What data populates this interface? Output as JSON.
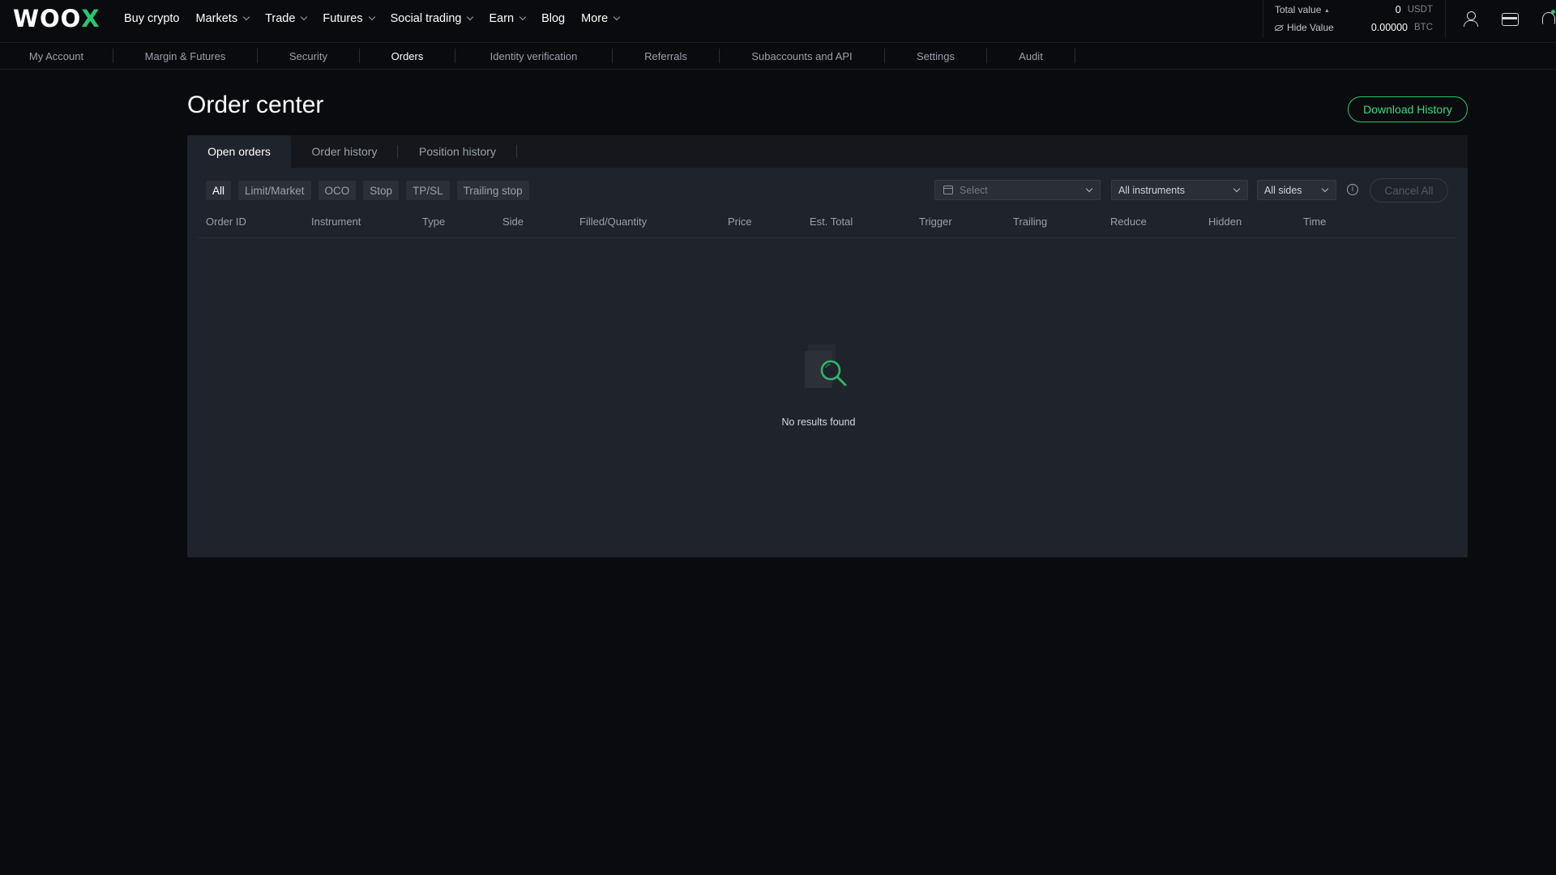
{
  "brand": {
    "logo_main": "WOO",
    "logo_accent": "X"
  },
  "topnav": {
    "items": [
      {
        "label": "Buy crypto",
        "has_menu": false
      },
      {
        "label": "Markets",
        "has_menu": true
      },
      {
        "label": "Trade",
        "has_menu": true
      },
      {
        "label": "Futures",
        "has_menu": true
      },
      {
        "label": "Social trading",
        "has_menu": true
      },
      {
        "label": "Earn",
        "has_menu": true
      },
      {
        "label": "Blog",
        "has_menu": false
      },
      {
        "label": "More",
        "has_menu": true
      }
    ]
  },
  "wallet": {
    "total_label": "Total value",
    "total_value": "0",
    "total_currency": "USDT",
    "hide_label": "Hide Value",
    "btc_value": "0.00000",
    "btc_currency": "BTC"
  },
  "subnav": {
    "items": [
      "My Account",
      "Margin & Futures",
      "Security",
      "Orders",
      "Identity verification",
      "Referrals",
      "Subaccounts and API",
      "Settings",
      "Audit"
    ],
    "active": "Orders"
  },
  "page": {
    "title": "Order center",
    "download_label": "Download History"
  },
  "tabs": {
    "items": [
      "Open orders",
      "Order history",
      "Position history"
    ],
    "active": "Open orders"
  },
  "filters": {
    "chips": [
      "All",
      "Limit/Market",
      "OCO",
      "Stop",
      "TP/SL",
      "Trailing stop"
    ],
    "active": "All",
    "date_placeholder": "Select",
    "instrument_value": "All instruments",
    "side_value": "All sides",
    "cancel_all_label": "Cancel All"
  },
  "table": {
    "columns": [
      "Order ID",
      "Instrument",
      "Type",
      "Side",
      "Filled/Quantity",
      "Price",
      "Est. Total",
      "Trigger",
      "Trailing",
      "Reduce",
      "Hidden",
      "Time"
    ],
    "rows": []
  },
  "empty_state": {
    "text": "No results found"
  },
  "colors": {
    "accent": "#28c76f",
    "background": "#0a0b0e",
    "panel": "#1f232b",
    "tab_bar": "#15171c"
  }
}
